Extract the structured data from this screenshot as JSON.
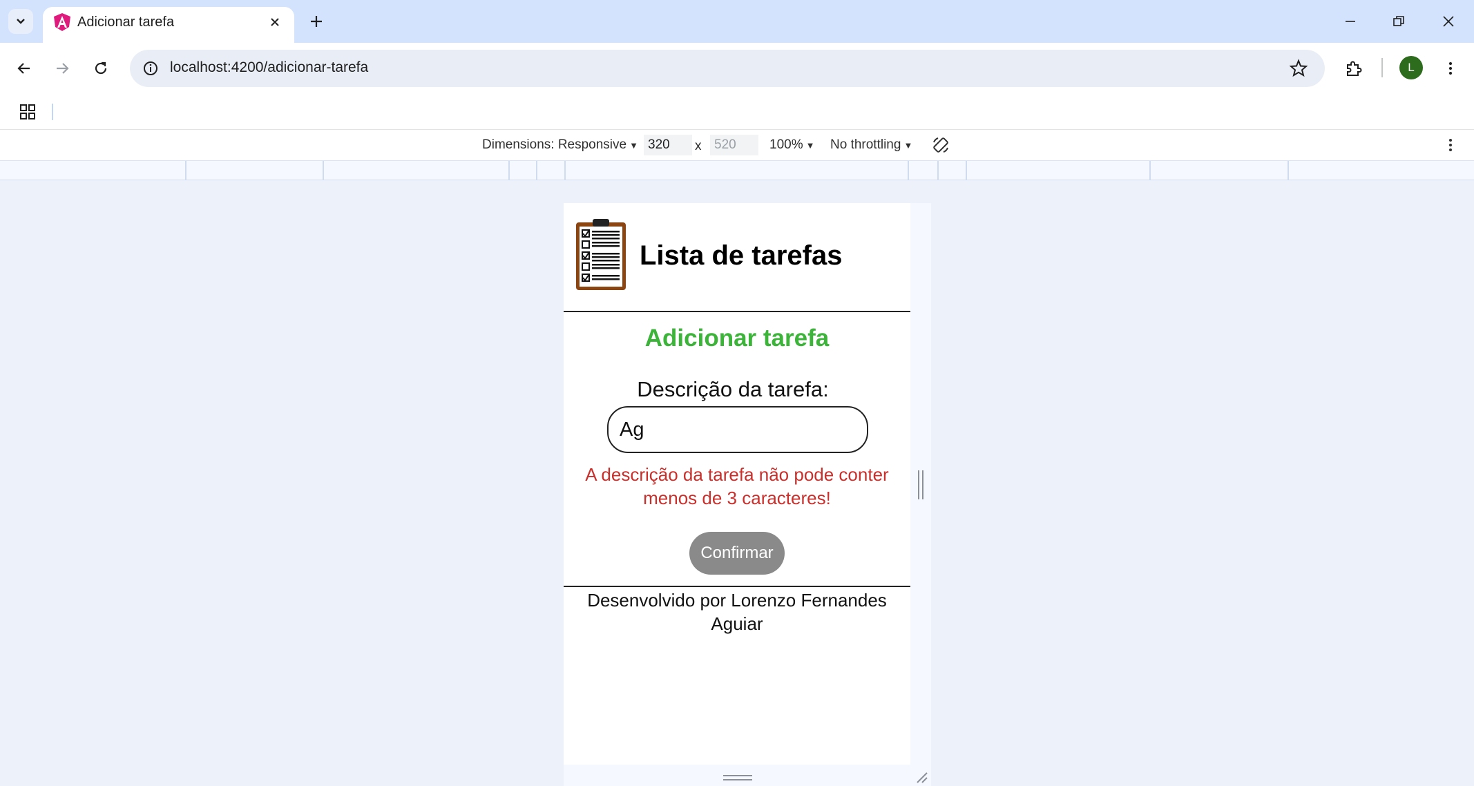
{
  "browser": {
    "tab": {
      "title": "Adicionar tarefa"
    },
    "omnibox": {
      "url": "localhost:4200/adicionar-tarefa"
    },
    "profile": {
      "initial": "L",
      "color": "#2d6b1d"
    }
  },
  "devtools": {
    "dimensions_label": "Dimensions: Responsive",
    "width": "320",
    "height": "520",
    "times": "x",
    "zoom": "100%",
    "throttling": "No throttling"
  },
  "app": {
    "title": "Lista de tarefas",
    "form": {
      "heading": "Adicionar tarefa",
      "field_label": "Descrição da tarefa:",
      "input_value": "Ag",
      "error": "A descrição da tarefa não pode conter menos de 3 caracteres!",
      "confirm_label": "Confirmar"
    },
    "footer": "Desenvolvido por Lorenzo Fernandes Aguiar",
    "colors": {
      "heading": "#3cb339",
      "error": "#c9302c",
      "button": "#8a8a8a"
    }
  }
}
